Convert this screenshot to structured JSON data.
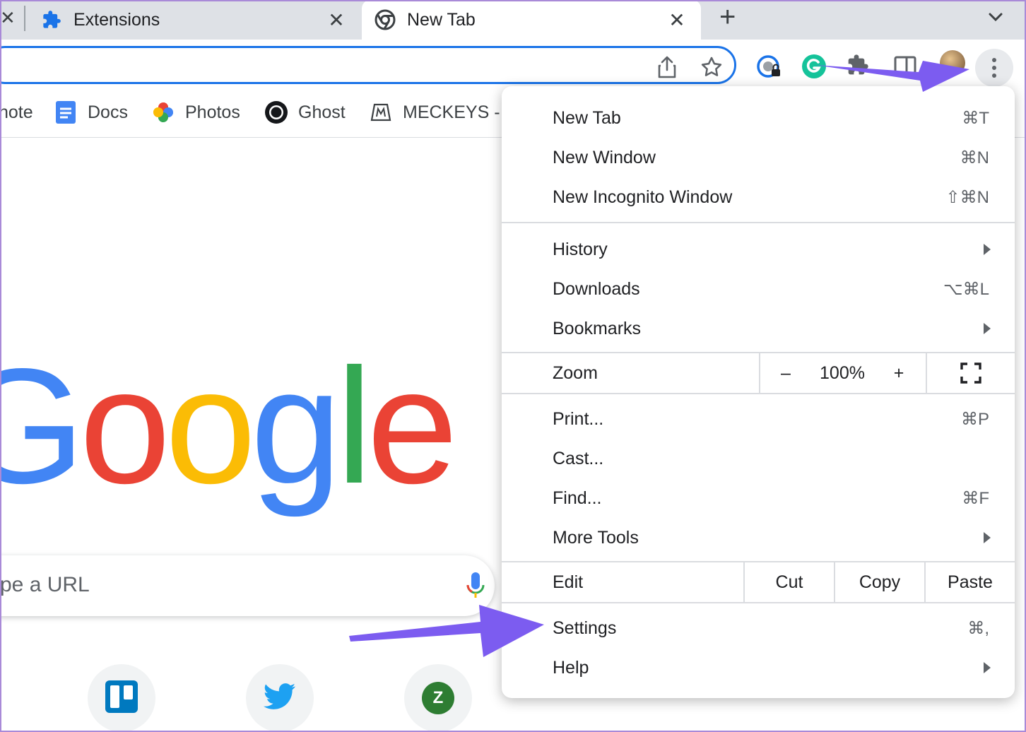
{
  "tabs": [
    {
      "label": "Extensions",
      "icon": "puzzle-icon",
      "active": false
    },
    {
      "label": "New Tab",
      "icon": "chrome-icon",
      "active": true
    }
  ],
  "tabstrip": {
    "left_close": "✕",
    "close_glyph": "✕",
    "new_tab_glyph": "+"
  },
  "bookmarks": [
    {
      "label": "note",
      "icon": "evernote-icon"
    },
    {
      "label": "Docs",
      "icon": "docs-icon"
    },
    {
      "label": "Photos",
      "icon": "photos-icon"
    },
    {
      "label": "Ghost",
      "icon": "ghost-icon"
    },
    {
      "label": "MECKEYS -",
      "icon": "meckeys-icon"
    }
  ],
  "page": {
    "logo_text": [
      "G",
      "o",
      "o",
      "g",
      "l",
      "e"
    ],
    "search_placeholder": "pe a URL",
    "shortcuts": [
      {
        "icon": "trello-icon"
      },
      {
        "icon": "twitter-icon"
      },
      {
        "icon": "zoho-icon",
        "letter": "Z"
      }
    ]
  },
  "menu": {
    "group1": [
      {
        "label": "New Tab",
        "shortcut": "⌘T"
      },
      {
        "label": "New Window",
        "shortcut": "⌘N"
      },
      {
        "label": "New Incognito Window",
        "shortcut": "⇧⌘N"
      }
    ],
    "group2": [
      {
        "label": "History",
        "submenu": true
      },
      {
        "label": "Downloads",
        "shortcut": "⌥⌘L"
      },
      {
        "label": "Bookmarks",
        "submenu": true
      }
    ],
    "zoom": {
      "label": "Zoom",
      "minus": "–",
      "value": "100%",
      "plus": "+"
    },
    "group3": [
      {
        "label": "Print...",
        "shortcut": "⌘P"
      },
      {
        "label": "Cast..."
      },
      {
        "label": "Find...",
        "shortcut": "⌘F"
      },
      {
        "label": "More Tools",
        "submenu": true
      }
    ],
    "edit": {
      "label": "Edit",
      "cut": "Cut",
      "copy": "Copy",
      "paste": "Paste"
    },
    "group4": [
      {
        "label": "Settings",
        "shortcut": "⌘,"
      },
      {
        "label": "Help",
        "submenu": true
      }
    ]
  },
  "colors": {
    "accent": "#1a73e8",
    "annotation_arrow": "#7c5cf0"
  }
}
